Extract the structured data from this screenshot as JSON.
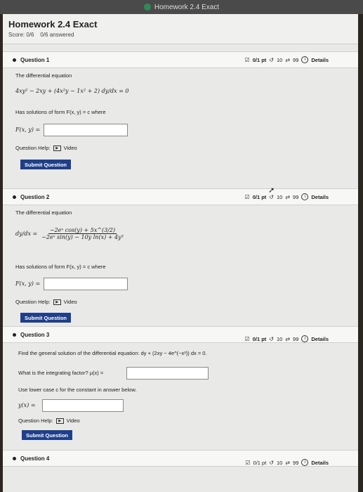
{
  "browser": {
    "tab_title": "Homework 2.4 Exact"
  },
  "header": {
    "title": "Homework 2.4 Exact",
    "score": "Score: 0/6",
    "answered": "0/6 answered"
  },
  "questions": [
    {
      "label": "Question 1",
      "points": "0/1 pt",
      "retries": "10",
      "attempts": "99",
      "details": "Details",
      "intro": "The differential equation",
      "equation": "4xy² − 2xy + (4x²y − 1x² + 2) dy/dx = 0",
      "form_text": "Has solutions of form F(x, y) = c where",
      "answer_label": "F(x, y) =",
      "answer_value": "",
      "help_label": "Question Help:",
      "video_label": "Video",
      "submit_label": "Submit Question"
    },
    {
      "label": "Question 2",
      "points": "0/1 pt",
      "retries": "10",
      "attempts": "99",
      "details": "Details",
      "intro": "The differential equation",
      "lhs": "dy/dx =",
      "numerator": "−2eˣ cos(y) + 5x^(3/2)",
      "denominator": "−2eˣ sin(y) − 10y ln(x) + 4y³",
      "form_text": "Has solutions of form F(x, y) = c where",
      "answer_label": "F(x, y) =",
      "answer_value": "",
      "help_label": "Question Help:",
      "video_label": "Video",
      "submit_label": "Submit Question"
    },
    {
      "label": "Question 3",
      "points": "0/1 pt",
      "retries": "10",
      "attempts": "99",
      "details": "Details",
      "prompt": "Find the general solution of the differential equation: dy + (2xy − 4e^(−x²)) dx = 0.",
      "integrating_label": "What is the integrating factor? μ(x) =",
      "integrating_value": "",
      "note": "Use lower case c for the constant in answer below.",
      "y_label": "y(x) =",
      "y_value": "",
      "help_label": "Question Help:",
      "video_label": "Video",
      "submit_label": "Submit Question"
    },
    {
      "label": "Question 4",
      "points": "0/1 pt",
      "retries": "10",
      "attempts": "99",
      "details": "Details"
    }
  ]
}
